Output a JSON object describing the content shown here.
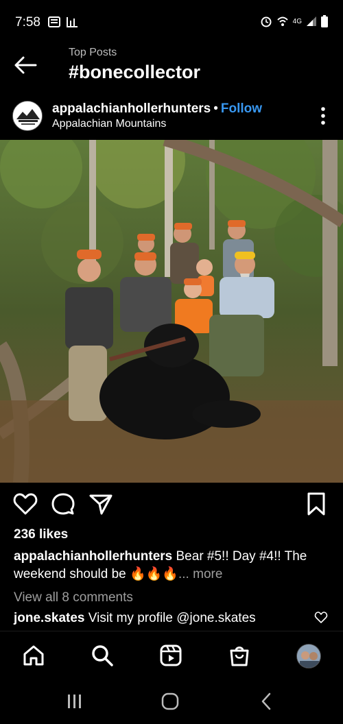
{
  "status_bar": {
    "time": "7:58",
    "network": "4G"
  },
  "header": {
    "subtitle": "Top Posts",
    "title": "#bonecollector"
  },
  "post": {
    "username": "appalachianhollerhunters",
    "separator": "•",
    "follow_label": "Follow",
    "location": "Appalachian Mountains",
    "likes": "236 likes",
    "caption_user": "appalachianhollerhunters",
    "caption_text": " Bear #5!! Day #4!! The weekend should be 🔥🔥🔥",
    "caption_more": "... more",
    "view_comments": "View all 8 comments",
    "comment_user": "jone.skates",
    "comment_text": " Visit my profile @jone.skates"
  },
  "bottom_nav": {
    "items": [
      "home",
      "search",
      "reels",
      "shop",
      "profile"
    ]
  },
  "colors": {
    "background": "#000000",
    "follow_blue": "#3897f0",
    "muted_gray": "#9e9e9e"
  }
}
